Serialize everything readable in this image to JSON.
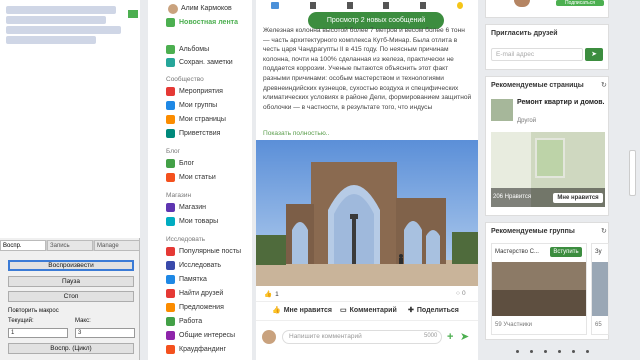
{
  "macro": {
    "tabs": [
      "Воспр.",
      "Запись",
      "Manage"
    ],
    "play_label": "Воспроизвести",
    "pause_label": "Пауза",
    "stop_label": "Стоп",
    "repeat_label": "Повторить макрос",
    "current_label": "Текущий:",
    "max_label": "Макс:",
    "current_value": "1",
    "max_value": "3",
    "loop_label": "Воспр. (Цикл)"
  },
  "nav": {
    "user_name": "Алим Кармоков",
    "items_top": [
      {
        "label": "Новостная лента",
        "color": "#4caf50"
      },
      {
        "label": "Альбомы",
        "color": "#4caf50"
      },
      {
        "label": "Сохран. заметки",
        "color": "#26a69a"
      }
    ],
    "section_community": "Сообщество",
    "items_community": [
      {
        "label": "Мероприятия",
        "color": "#e53935"
      },
      {
        "label": "Мои группы",
        "color": "#1e88e5"
      },
      {
        "label": "Мои страницы",
        "color": "#fb8c00"
      },
      {
        "label": "Приветствия",
        "color": "#00897b"
      }
    ],
    "section_blog": "Блог",
    "items_blog": [
      {
        "label": "Блог",
        "color": "#43a047"
      },
      {
        "label": "Мои статьи",
        "color": "#f4511e"
      }
    ],
    "section_shop": "Магазин",
    "items_shop": [
      {
        "label": "Магазин",
        "color": "#5e35b1"
      },
      {
        "label": "Мои товары",
        "color": "#00acc1"
      }
    ],
    "section_explore": "Исследовать",
    "items_explore": [
      {
        "label": "Популярные посты",
        "color": "#e53935"
      },
      {
        "label": "Исследовать",
        "color": "#3949ab"
      },
      {
        "label": "Памятка",
        "color": "#1e88e5"
      },
      {
        "label": "Найти друзей",
        "color": "#e53935"
      },
      {
        "label": "Предложения",
        "color": "#fb8c00"
      },
      {
        "label": "Работа",
        "color": "#43a047"
      },
      {
        "label": "Общие интересы",
        "color": "#8e24aa"
      },
      {
        "label": "Краудфандинг",
        "color": "#f4511e"
      }
    ]
  },
  "feed": {
    "toast": "Просмотр 2 новых сообщений",
    "post_text": "Железная колонна высотой более 7 метров и весом более 6 тонн — часть архитектурного комплекса Кутб-Минар. Была отлита в честь царя Чандрагупты II в 415 году. По неясным причинам колонна, почти на 100% сделанная из железа, практически не поддается коррозии. Ученые пытаются объяснить этот факт разными причинами: особым мастерством и технологиями древнеиндийских кузнецов, сухостью воздуха и специфических климатических условиях в районе Дели, формированием защитной оболочки — в частности, в результате того, что индусы",
    "show_more": "Показать полностью..",
    "likes_count": "1",
    "comments_count": "0",
    "like_label": "Мне нравится",
    "comment_label": "Комментарий",
    "share_label": "Поделиться",
    "comment_placeholder": "Напишите комментарий",
    "char_limit": "5000"
  },
  "right": {
    "top_button": "Подписаться",
    "invite_title": "Пригласить друзей",
    "email_placeholder": "E-mail адрес",
    "pages_title": "Рекомендуемые страницы",
    "page_name": "Ремонт квартир и домов.",
    "page_category": "Другой",
    "page_likes": "206 Нравится",
    "page_like_button": "Мне нравится",
    "groups_title": "Рекомендуемые группы",
    "group_name": "Мастерство С...",
    "group_join": "Вступить",
    "group_members": "59 Участники",
    "group2_name": "Зу",
    "group2_members": "65"
  }
}
